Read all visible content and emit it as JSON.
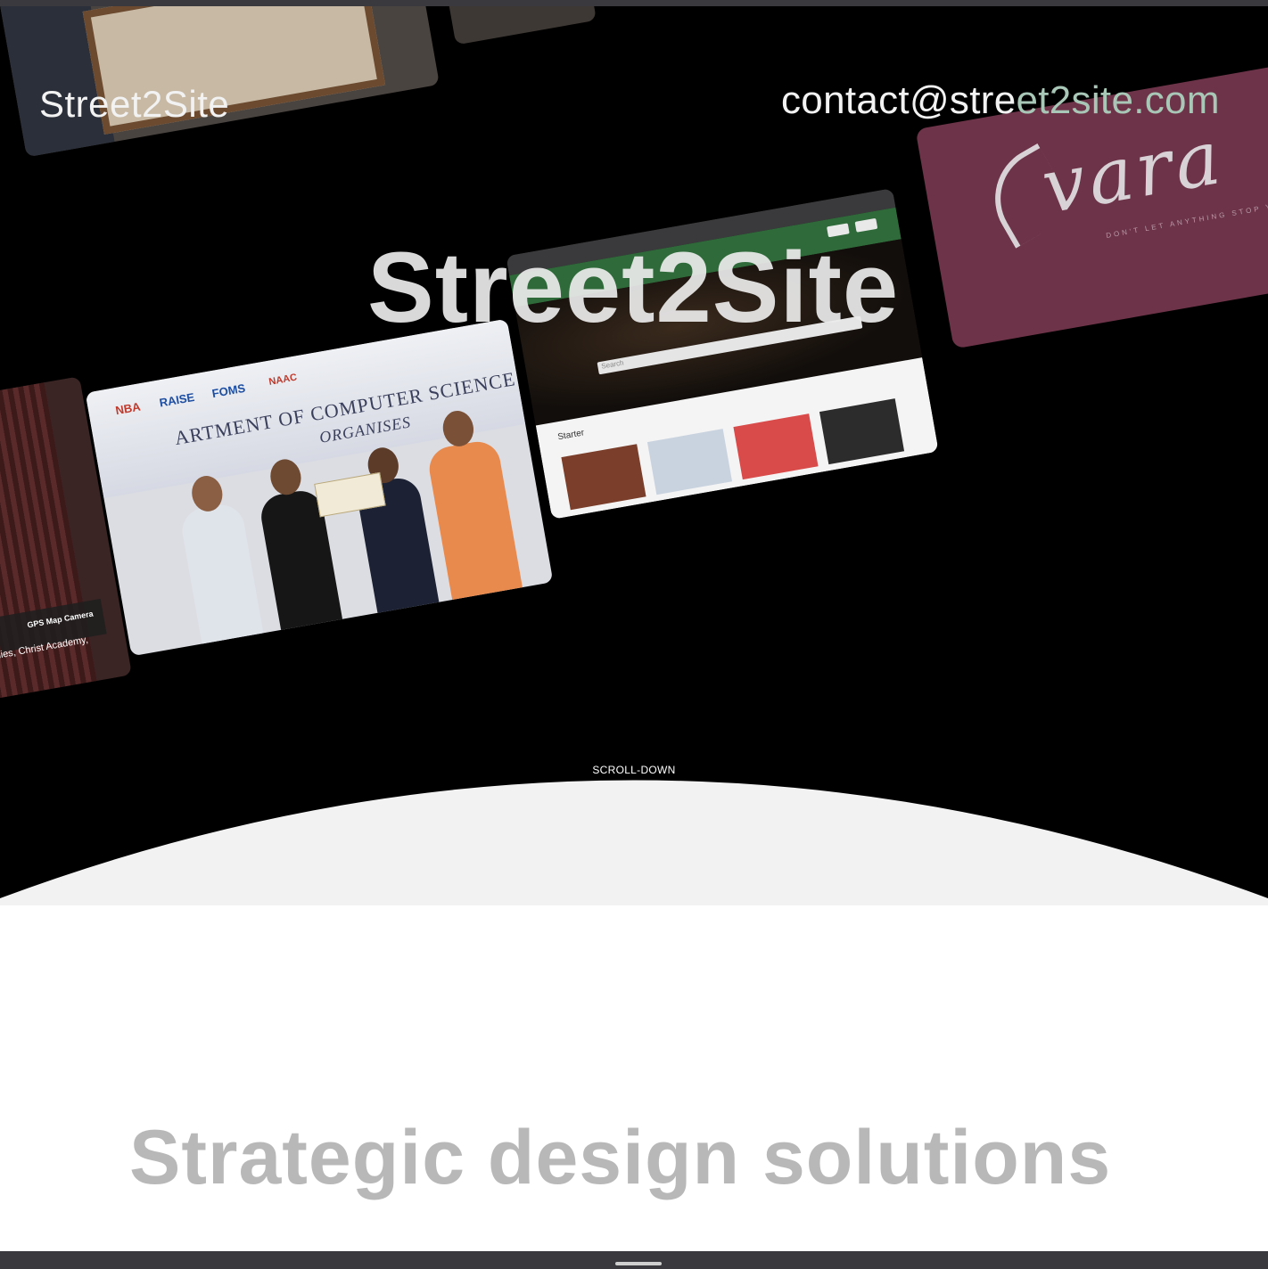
{
  "header": {
    "brand": "Street2Site",
    "email_prefix": "contact@stre",
    "email_suffix": "et2site.com"
  },
  "hero": {
    "title": "Street2Site",
    "scroll_hint": "SCROLL-DOWN"
  },
  "showcase": {
    "award_banner_logos": [
      "NBA",
      "RAISE",
      "FOMS",
      "NAAC"
    ],
    "award_banner_text": "ARTMENT OF COMPUTER SCIENCE",
    "award_banner_sub": "ORGANISES",
    "left_photo_stamp": "GPS Map Camera",
    "left_photo_caption": "dies, Christ Academy,",
    "web_section_label": "Starter",
    "web_search_placeholder": "Search",
    "vara_word": "vara",
    "vara_tagline": "DON'T LET ANYTHING STOP YOU"
  },
  "intro": {
    "tagline": "Strategic design solutions"
  },
  "colors": {
    "hero_bg": "#000000",
    "arc_fill": "#f2f2f2",
    "email_accent": "#a9c7b7",
    "tagline": "#b8b8b8",
    "vara_card": "#6d3348"
  }
}
